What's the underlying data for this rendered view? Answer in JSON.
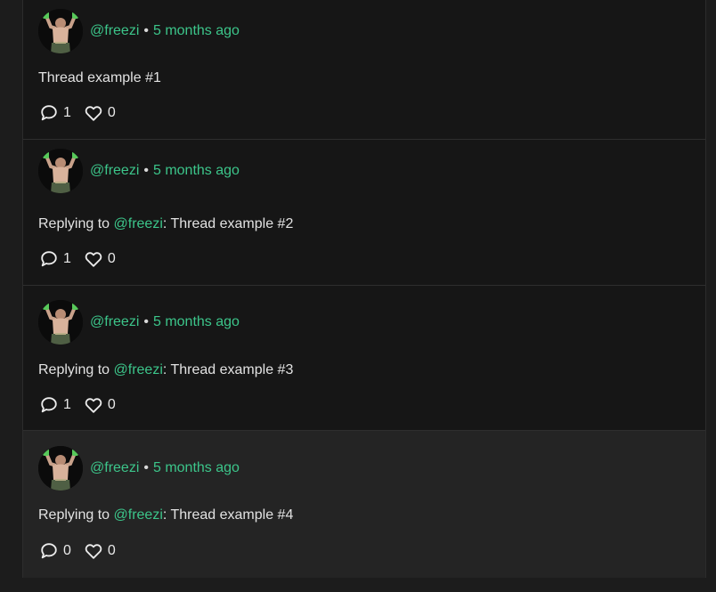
{
  "posts": [
    {
      "handle": "@freezi",
      "time": "5 months ago",
      "reply_prefix": "",
      "mention": "",
      "sep": "",
      "text": "Thread example #1",
      "replies": "1",
      "likes": "0"
    },
    {
      "handle": "@freezi",
      "time": "5 months ago",
      "reply_prefix": "Replying to ",
      "mention": "@freezi",
      "sep": ": ",
      "text": "Thread example #2",
      "replies": "1",
      "likes": "0"
    },
    {
      "handle": "@freezi",
      "time": "5 months ago",
      "reply_prefix": "Replying to ",
      "mention": "@freezi",
      "sep": ": ",
      "text": "Thread example #3",
      "replies": "1",
      "likes": "0"
    },
    {
      "handle": "@freezi",
      "time": "5 months ago",
      "reply_prefix": "Replying to ",
      "mention": "@freezi",
      "sep": ": ",
      "text": "Thread example #4",
      "replies": "0",
      "likes": "0"
    }
  ],
  "separator": "•",
  "colors": {
    "accent": "#3cc58a",
    "post_bg": "#161616",
    "highlight_bg": "#242424",
    "page_bg": "#1c1c1c"
  },
  "icons": {
    "avatar": "user-avatar",
    "reply": "comment-icon",
    "like": "heart-icon"
  }
}
